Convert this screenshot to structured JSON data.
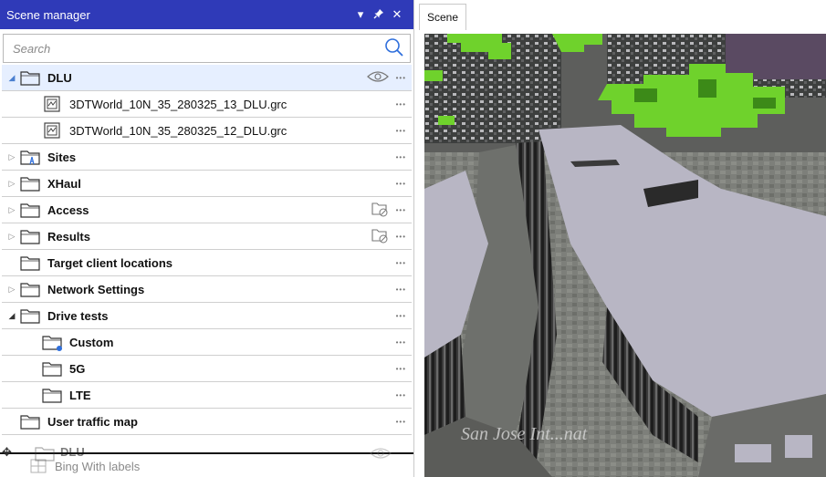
{
  "panel": {
    "title": "Scene manager",
    "pin_glyph": "✖",
    "dropdown_glyph": "▾",
    "close_glyph": "✕"
  },
  "search": {
    "placeholder": "Search",
    "value": ""
  },
  "scene_tab": {
    "label": "Scene"
  },
  "tree": [
    {
      "label": "DLU",
      "bold": true,
      "level": 0,
      "expander": "open-selected",
      "icon": "folder-icon",
      "eye": true,
      "selected": true
    },
    {
      "label": "3DTWorld_10N_35_280325_13_DLU.grc",
      "bold": false,
      "level": 1,
      "expander": "none",
      "icon": "terrain-file-icon"
    },
    {
      "label": "3DTWorld_10N_35_280325_12_DLU.grc",
      "bold": false,
      "level": 1,
      "expander": "none",
      "icon": "terrain-file-icon"
    },
    {
      "label": "Sites",
      "bold": true,
      "level": 0,
      "expander": "closed",
      "icon": "sites-folder-icon"
    },
    {
      "label": "XHaul",
      "bold": true,
      "level": 0,
      "expander": "closed",
      "icon": "folder-icon"
    },
    {
      "label": "Access",
      "bold": true,
      "level": 0,
      "expander": "closed",
      "icon": "folder-icon",
      "hidden_eye": true
    },
    {
      "label": "Results",
      "bold": true,
      "level": 0,
      "expander": "closed",
      "icon": "folder-icon",
      "hidden_eye": true
    },
    {
      "label": "Target client locations",
      "bold": true,
      "level": 0,
      "expander": "none",
      "icon": "folder-icon"
    },
    {
      "label": "Network Settings",
      "bold": true,
      "level": 0,
      "expander": "closed",
      "icon": "folder-icon"
    },
    {
      "label": "Drive tests",
      "bold": true,
      "level": 0,
      "expander": "open",
      "icon": "folder-icon"
    },
    {
      "label": "Custom",
      "bold": true,
      "level": 1,
      "expander": "none",
      "icon": "custom-folder-icon"
    },
    {
      "label": "5G",
      "bold": true,
      "level": 1,
      "expander": "none",
      "icon": "folder-icon"
    },
    {
      "label": "LTE",
      "bold": true,
      "level": 1,
      "expander": "none",
      "icon": "folder-icon"
    },
    {
      "label": "User traffic map",
      "bold": true,
      "level": 0,
      "expander": "none",
      "icon": "folder-icon"
    }
  ],
  "drag_ghost": {
    "label": "DLU",
    "under_label": "Bing With labels"
  },
  "scene": {
    "overlay_text": "San Jose Int...nat"
  },
  "colors": {
    "titlebar": "#2f3ab8",
    "selected_row": "#e6efff",
    "accent": "#2f6fdc",
    "vegetation": "#6fd22c",
    "building": "#b8b6c4"
  }
}
